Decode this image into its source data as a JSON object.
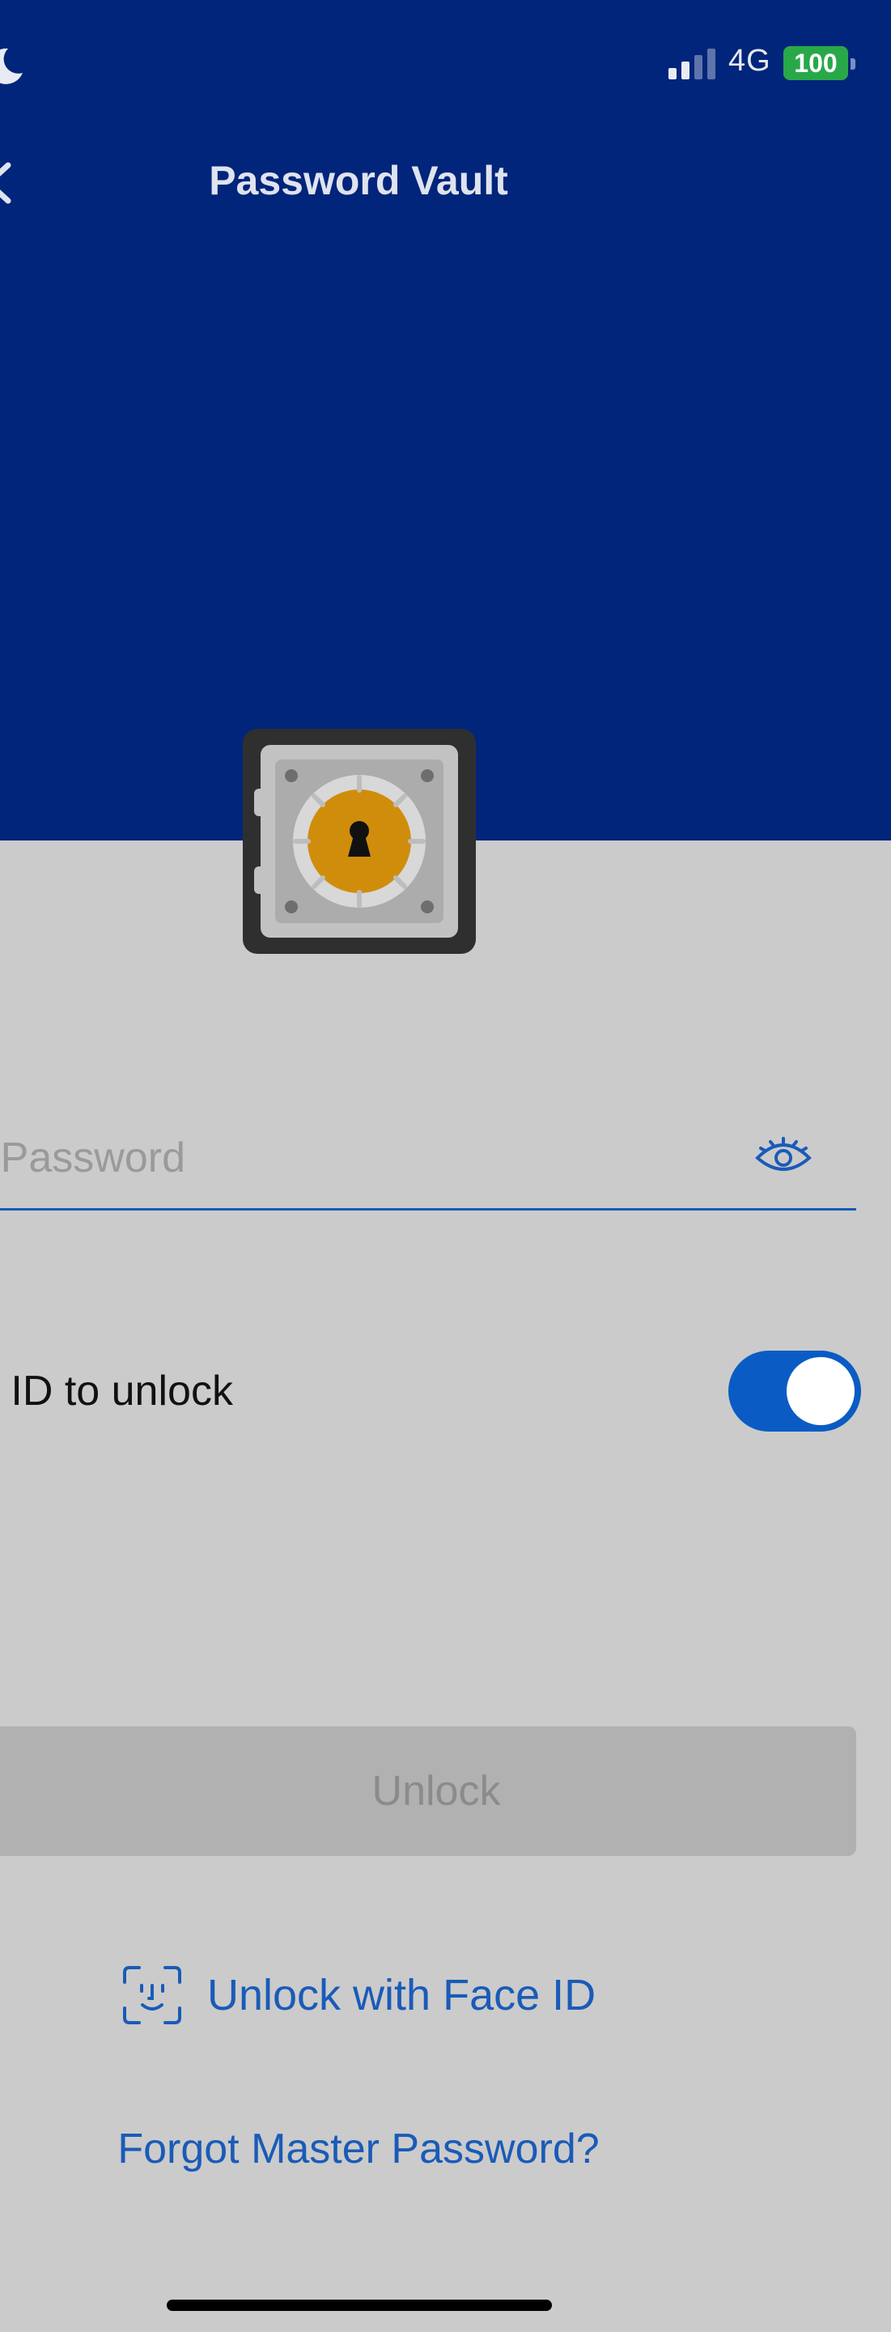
{
  "status_bar": {
    "moon_icon": "moon-icon",
    "signal_icon": "cellular-signal-icon",
    "network": "4G",
    "battery": "100"
  },
  "nav": {
    "back_icon": "chevron-left-icon",
    "title": "Password Vault"
  },
  "hero": {
    "icon": "vault-safe-icon",
    "colors": {
      "header_bg": "#00257a",
      "dial": "#d08d0c"
    }
  },
  "password_field": {
    "placeholder": "Enter Master Password",
    "visible_placeholder": "er Password",
    "value": "",
    "toggle_icon": "eye-icon"
  },
  "face_id_toggle": {
    "label": "ce ID to unlock",
    "enabled": true
  },
  "buttons": {
    "unlock": "Unlock",
    "unlock_face_id": "Unlock with Face ID",
    "face_id_icon": "face-id-icon",
    "forgot": "Forgot Master Password?"
  },
  "theme": {
    "accent": "#1a5bb8",
    "toggle_on": "#0a5cc4",
    "background": "#cbcbcb"
  }
}
